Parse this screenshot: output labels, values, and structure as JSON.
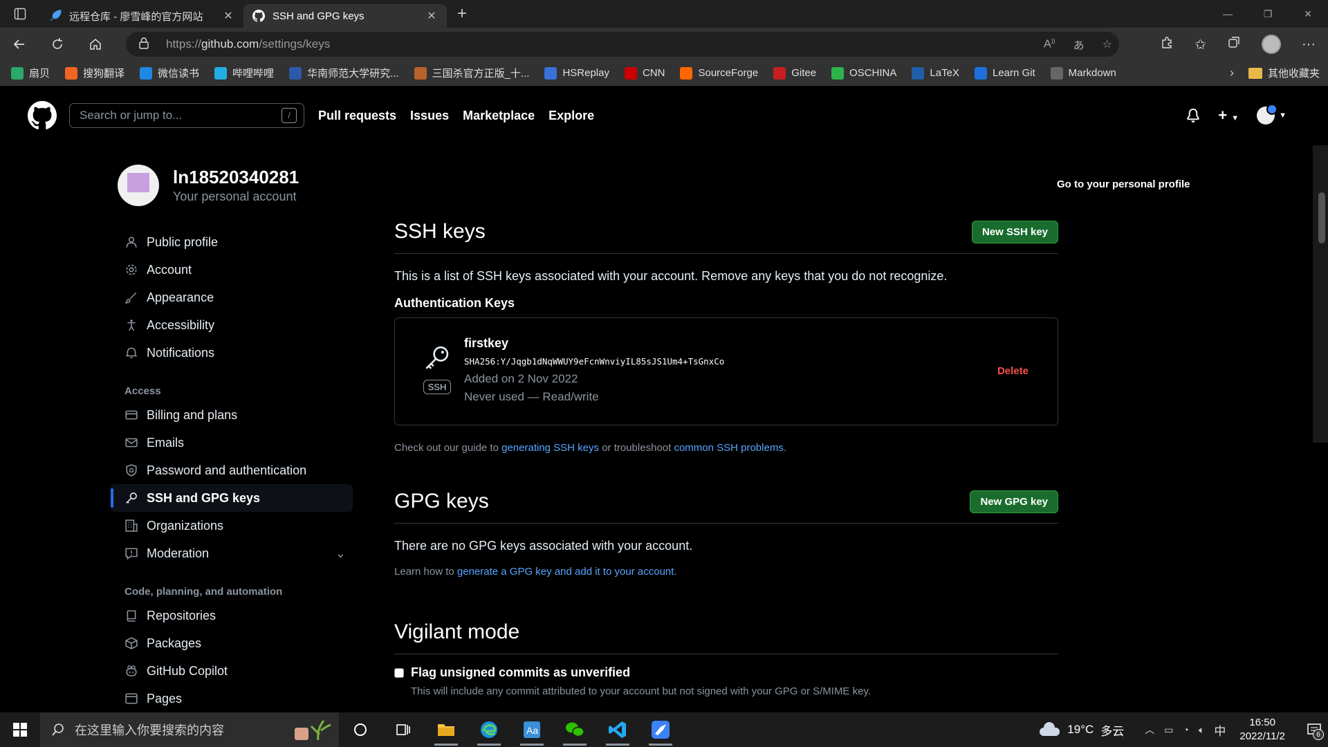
{
  "browser": {
    "tabs": [
      {
        "title": "远程仓库 - 廖雪峰的官方网站",
        "icon": "rocket-icon",
        "active": false
      },
      {
        "title": "SSH and GPG keys",
        "icon": "github-icon",
        "active": true
      }
    ],
    "url_prefix": "https://",
    "url_domain": "github.com",
    "url_path": "/settings/keys",
    "bookmarks": [
      {
        "label": "扇贝",
        "color": "#2ca86a"
      },
      {
        "label": "搜狗翻译",
        "color": "#f26522"
      },
      {
        "label": "微信读书",
        "color": "#1e88e5"
      },
      {
        "label": "哔哩哔哩",
        "color": "#23ade5"
      },
      {
        "label": "华南师范大学研究...",
        "color": "#2b5aa8"
      },
      {
        "label": "三国杀官方正版_十...",
        "color": "#b8632c"
      },
      {
        "label": "HSReplay",
        "color": "#3a70d8"
      },
      {
        "label": "CNN",
        "color": "#cc0000"
      },
      {
        "label": "SourceForge",
        "color": "#ff6600"
      },
      {
        "label": "Gitee",
        "color": "#c71d23"
      },
      {
        "label": "OSCHINA",
        "color": "#2cb44a"
      },
      {
        "label": "LaTeX",
        "color": "#1f5fa8"
      },
      {
        "label": "Learn Git",
        "color": "#1e6fd9"
      },
      {
        "label": "Markdown",
        "color": "#666666"
      }
    ],
    "other_bookmarks": "其他收藏夹"
  },
  "github": {
    "search_placeholder": "Search or jump to...",
    "search_shortcut": "/",
    "nav": [
      "Pull requests",
      "Issues",
      "Marketplace",
      "Explore"
    ]
  },
  "profile": {
    "username": "ln18520340281",
    "subtitle": "Your personal account",
    "personal_link": "Go to your personal profile"
  },
  "sidebar": {
    "items_top": [
      {
        "label": "Public profile",
        "icon": "person-icon"
      },
      {
        "label": "Account",
        "icon": "gear-icon"
      },
      {
        "label": "Appearance",
        "icon": "paintbrush-icon"
      },
      {
        "label": "Accessibility",
        "icon": "accessibility-icon"
      },
      {
        "label": "Notifications",
        "icon": "bell-icon"
      }
    ],
    "access_heading": "Access",
    "items_access": [
      {
        "label": "Billing and plans",
        "icon": "credit-card-icon"
      },
      {
        "label": "Emails",
        "icon": "mail-icon"
      },
      {
        "label": "Password and authentication",
        "icon": "shield-icon"
      },
      {
        "label": "SSH and GPG keys",
        "icon": "key-icon",
        "active": true
      },
      {
        "label": "Organizations",
        "icon": "organization-icon"
      },
      {
        "label": "Moderation",
        "icon": "report-icon",
        "expandable": true
      }
    ],
    "code_heading": "Code, planning, and automation",
    "items_code": [
      {
        "label": "Repositories",
        "icon": "repo-icon"
      },
      {
        "label": "Packages",
        "icon": "package-icon"
      },
      {
        "label": "GitHub Copilot",
        "icon": "copilot-icon"
      },
      {
        "label": "Pages",
        "icon": "browser-icon"
      }
    ]
  },
  "ssh": {
    "title": "SSH keys",
    "new_button": "New SSH key",
    "description": "This is a list of SSH keys associated with your account. Remove any keys that you do not recognize.",
    "auth_heading": "Authentication Keys",
    "key": {
      "name": "firstkey",
      "badge": "SSH",
      "fingerprint": "SHA256:Y/Jqgb1dNqWWUY9eFcnWnviyIL85sJS1Um4+TsGnxCo",
      "added": "Added on 2 Nov 2022",
      "usage": "Never used — Read/write",
      "delete_label": "Delete"
    },
    "guide_pre": "Check out our guide to ",
    "guide_link1": "generating SSH keys",
    "guide_mid": " or troubleshoot ",
    "guide_link2": "common SSH problems",
    "guide_post": "."
  },
  "gpg": {
    "title": "GPG keys",
    "new_button": "New GPG key",
    "description": "There are no GPG keys associated with your account.",
    "learn_pre": "Learn how to ",
    "learn_link1": "generate a GPG key and add it to your account",
    "learn_post": "."
  },
  "vigilant": {
    "title": "Vigilant mode",
    "checkbox_label": "Flag unsigned commits as unverified",
    "checkbox_checked": false,
    "sub": "This will include any commit attributed to your account but not signed with your GPG or S/MIME key."
  },
  "taskbar": {
    "search_placeholder": "在这里输入你要搜索的内容",
    "weather_temp": "19°C",
    "weather_desc": "多云",
    "ime": "中",
    "time": "16:50",
    "date": "2022/11/2",
    "notif_count": "6"
  }
}
